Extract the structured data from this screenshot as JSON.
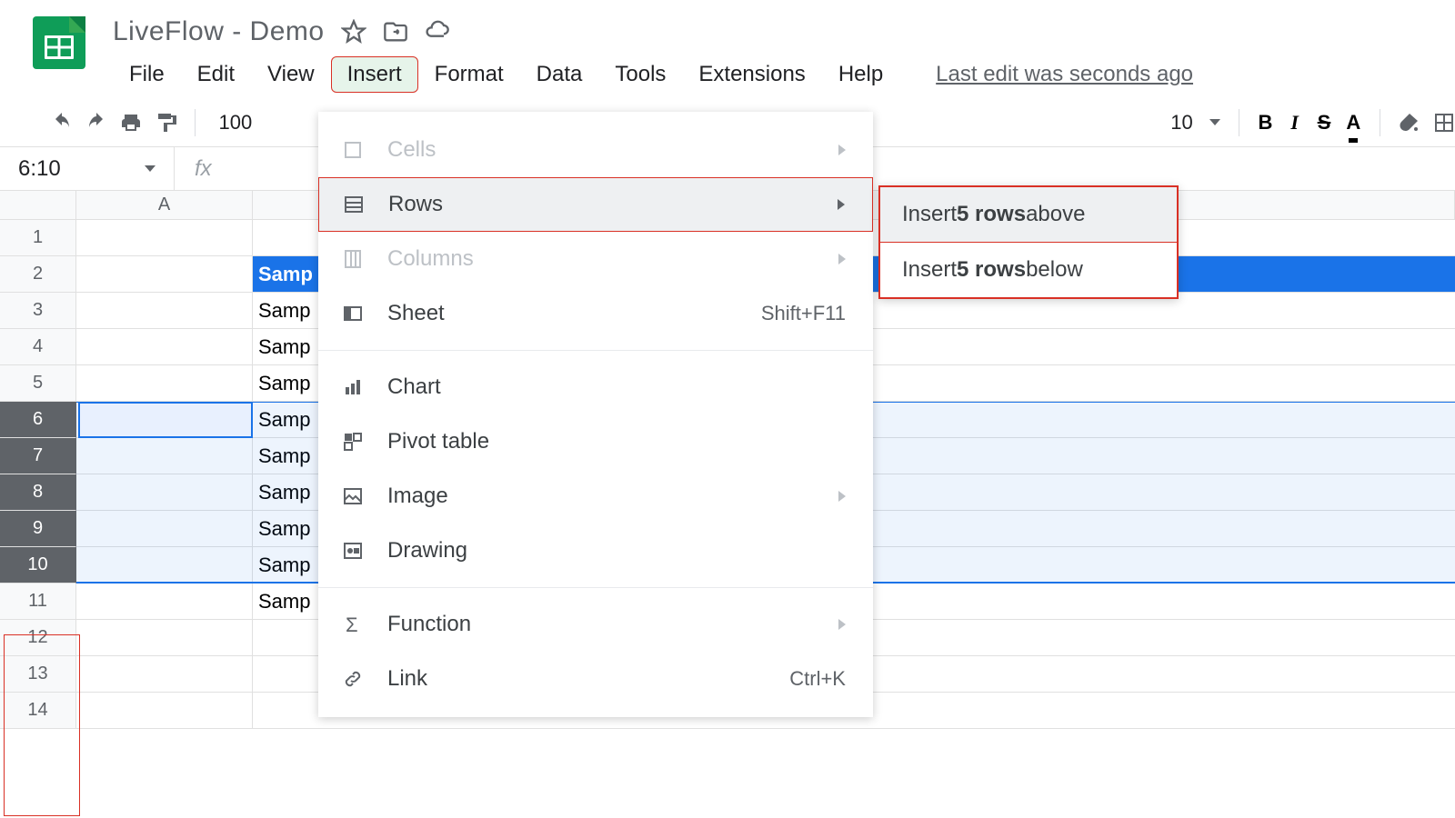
{
  "doc_title": "LiveFlow - Demo",
  "last_edit": "Last edit was seconds ago",
  "menubar": {
    "file": "File",
    "edit": "Edit",
    "view": "View",
    "insert": "Insert",
    "format": "Format",
    "data": "Data",
    "tools": "Tools",
    "extensions": "Extensions",
    "help": "Help"
  },
  "toolbar": {
    "zoom": "100",
    "font_size": "10"
  },
  "name_box": "6:10",
  "col_a": "A",
  "rows": {
    "r1": "1",
    "r2": "2",
    "r3": "3",
    "r4": "4",
    "r5": "5",
    "r6": "6",
    "r7": "7",
    "r8": "8",
    "r9": "9",
    "r10": "10",
    "r11": "11",
    "r12": "12",
    "r13": "13",
    "r14": "14"
  },
  "cells": {
    "b2": "Samp",
    "b3": "Samp",
    "b4": "Samp",
    "b5": "Samp",
    "b6": "Samp",
    "b7": "Samp",
    "b8": "Samp",
    "b9": "Samp",
    "b10": "Samp",
    "b11": "Samp"
  },
  "insert_menu": {
    "cells": "Cells",
    "rows": "Rows",
    "columns": "Columns",
    "sheet": "Sheet",
    "sheet_shortcut": "Shift+F11",
    "chart": "Chart",
    "pivot": "Pivot table",
    "image": "Image",
    "drawing": "Drawing",
    "function": "Function",
    "link": "Link",
    "link_shortcut": "Ctrl+K"
  },
  "submenu": {
    "above_pre": "Insert ",
    "above_bold": "5 rows",
    "above_post": " above",
    "below_pre": "Insert ",
    "below_bold": "5 rows",
    "below_post": " below"
  }
}
